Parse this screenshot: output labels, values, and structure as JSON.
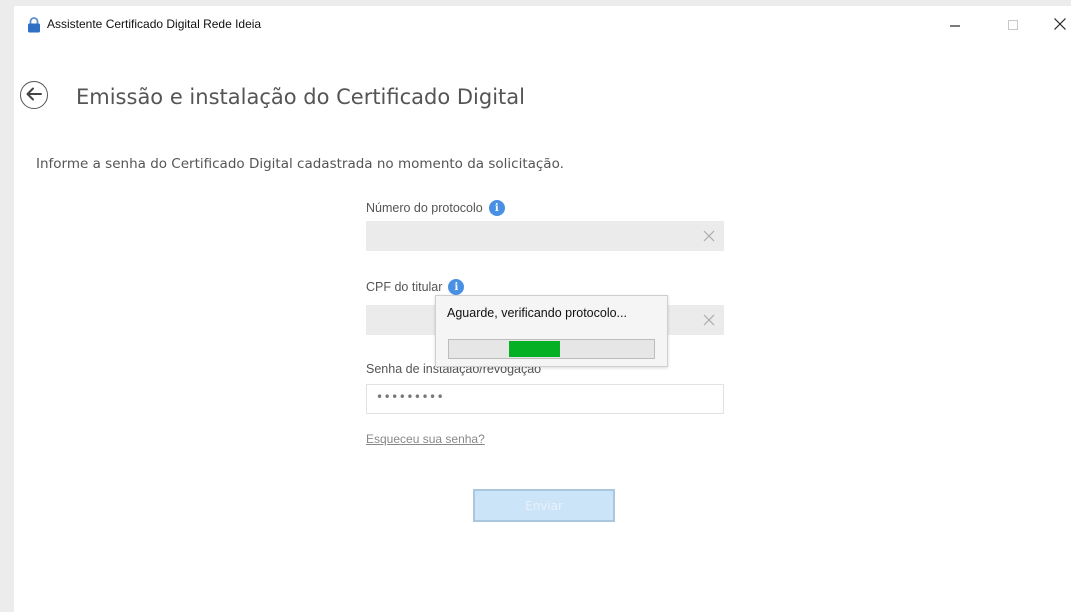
{
  "window": {
    "title": "Assistente Certificado Digital Rede Ideia",
    "icon": "lock-icon",
    "controls": [
      "minimize-icon",
      "maximize-icon",
      "close-icon"
    ]
  },
  "header": {
    "title": "Emissão e instalação do Certificado Digital",
    "back_icon": "arrow-left-icon"
  },
  "instruction": "Informe a senha do Certificado Digital cadastrada no momento da solicitação.",
  "form": {
    "protocol": {
      "label": "Número do protocolo",
      "value": ""
    },
    "cpf": {
      "label": "CPF do titular",
      "value": ""
    },
    "password": {
      "label": "Senha de instalação/revogação",
      "value": "•••••••••"
    },
    "forgot_link": "Esqueceu sua senha?",
    "submit_label": "Enviar"
  },
  "progress_dialog": {
    "message": "Aguarde, verificando protocolo...",
    "indeterminate": true
  },
  "colors": {
    "accent": "#4a90e2",
    "progress": "#06b025",
    "submit_disabled": "#cce4f7"
  }
}
